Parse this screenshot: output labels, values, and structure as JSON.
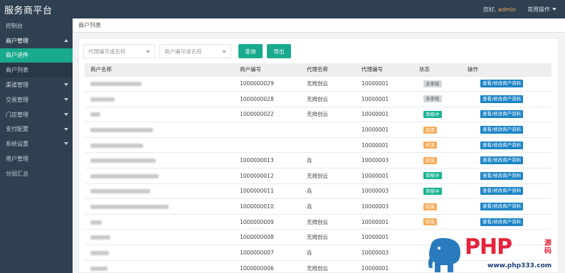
{
  "header": {
    "brand": "服务商平台",
    "greeting": "您好,",
    "user": "admin",
    "menu": "常用操作"
  },
  "sidebar": {
    "items": [
      {
        "label": "控制台",
        "type": "plain"
      },
      {
        "label": "商户管理",
        "type": "open"
      },
      {
        "label": "商户进件",
        "type": "active"
      },
      {
        "label": "商户列表",
        "type": "sub"
      },
      {
        "label": "渠道管理",
        "type": "collapsed"
      },
      {
        "label": "交易管理",
        "type": "collapsed"
      },
      {
        "label": "门店管理",
        "type": "collapsed"
      },
      {
        "label": "支付配置",
        "type": "collapsed"
      },
      {
        "label": "系统设置",
        "type": "collapsed"
      },
      {
        "label": "用户管理",
        "type": "plain"
      },
      {
        "label": "分润汇总",
        "type": "plain"
      }
    ]
  },
  "tabs": {
    "current": "商户列表"
  },
  "filters": {
    "agent_placeholder": "代理编号或名称",
    "merchant_placeholder": "商户编号或名称",
    "search_label": "查询",
    "export_label": "导出"
  },
  "table": {
    "columns": [
      "商户名称",
      "商户编号",
      "代理名称",
      "代理编号",
      "状态",
      "操作"
    ],
    "rows": [
      {
        "name_w": 72,
        "id": "1000000029",
        "agent": "无拇创云",
        "agent_id": "10000001",
        "status": "未审核",
        "status_color": "gray",
        "action": "查看/修改商户资料"
      },
      {
        "name_w": 34,
        "id": "1000000028",
        "agent": "无拇创云",
        "agent_id": "10000001",
        "status": "未审核",
        "status_color": "gray",
        "action": "查看/修改商户资料"
      },
      {
        "name_w": 14,
        "id": "1000000022",
        "agent": "无拇创云",
        "agent_id": "10000001",
        "status": "审核中",
        "status_color": "green",
        "action": "查看/修改商户资料"
      },
      {
        "name_w": 88,
        "id": "",
        "agent": "",
        "agent_id": "10000001",
        "status": "结束",
        "status_color": "yellow",
        "action": "查看/修改商户资料"
      },
      {
        "name_w": 74,
        "id": "",
        "agent": "",
        "agent_id": "10000001",
        "status": "结束",
        "status_color": "yellow",
        "action": "查看/修改商户资料"
      },
      {
        "name_w": 92,
        "id": "1000000013",
        "agent": "垚",
        "agent_id": "10000003",
        "status": "结束",
        "status_color": "yellow",
        "action": "查看/修改商户资料"
      },
      {
        "name_w": 96,
        "id": "1000000012",
        "agent": "无拇创云",
        "agent_id": "10000001",
        "status": "审核中",
        "status_color": "green",
        "action": "查看/修改商户资料"
      },
      {
        "name_w": 84,
        "id": "1000000011",
        "agent": "垚",
        "agent_id": "10000003",
        "status": "审核中",
        "status_color": "green",
        "action": "查看/修改商户资料"
      },
      {
        "name_w": 110,
        "id": "1000000010",
        "agent": "垚",
        "agent_id": "10000003",
        "status": "结束",
        "status_color": "yellow",
        "action": "查看/修改商户资料"
      },
      {
        "name_w": 16,
        "id": "1000000009",
        "agent": "无拇创云",
        "agent_id": "10000001",
        "status": "结束",
        "status_color": "yellow",
        "action": "查看/修改商户资料"
      },
      {
        "name_w": 28,
        "id": "1000000008",
        "agent": "无拇创云",
        "agent_id": "10000001",
        "status": "",
        "status_color": "",
        "action": ""
      },
      {
        "name_w": 26,
        "id": "1000000007",
        "agent": "垚",
        "agent_id": "10000003",
        "status": "",
        "status_color": "",
        "action": ""
      },
      {
        "name_w": 24,
        "id": "1000000006",
        "agent": "无拇创云",
        "agent_id": "10000001",
        "status": "",
        "status_color": "",
        "action": ""
      }
    ]
  },
  "watermark": {
    "logo": "PHP",
    "logo_cn": "源码",
    "url": "www.php333.com",
    "color": "#e5243b"
  }
}
